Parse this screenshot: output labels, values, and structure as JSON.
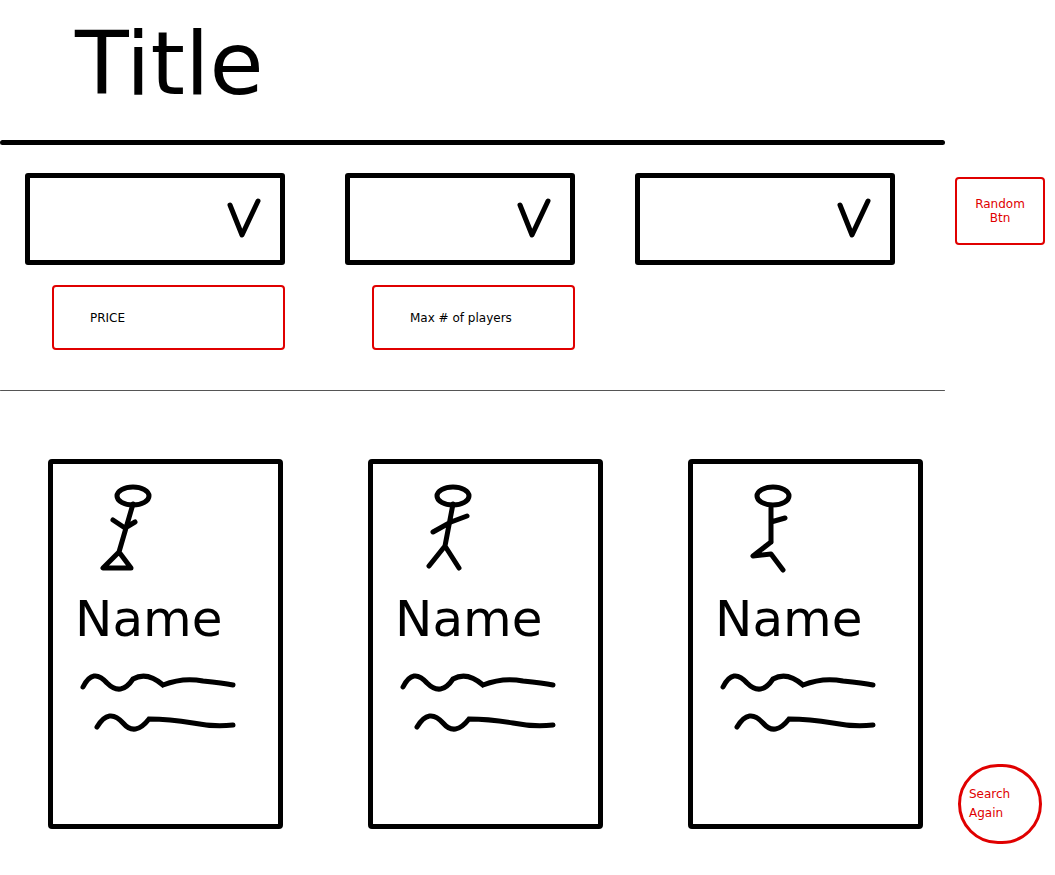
{
  "title": "Title",
  "filters": [
    {
      "caption": "PRICE"
    },
    {
      "caption": "Max # of players"
    },
    {}
  ],
  "random_button": "Random Btn",
  "cards": [
    {
      "name": "Name"
    },
    {
      "name": "Name"
    },
    {
      "name": "Name"
    }
  ],
  "search_again_button": "Search Again"
}
